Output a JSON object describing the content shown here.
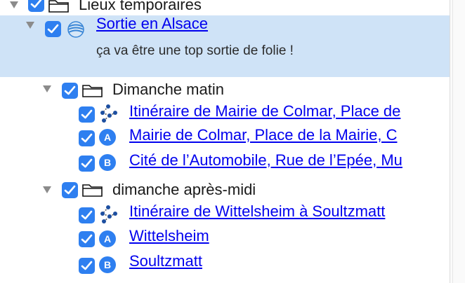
{
  "tree": {
    "root": {
      "label": "Lieux temporaires"
    },
    "sortie": {
      "title": "Sortie en Alsace",
      "description": "ça va être une top sortie de folie !"
    },
    "folders": [
      {
        "label": "Dimanche matin",
        "items": [
          {
            "type": "route",
            "icon": "route-icon",
            "label": "Itinéraire de Mairie de Colmar, Place de"
          },
          {
            "type": "marker-a",
            "icon": "marker-a-icon",
            "label": "Mairie de Colmar, Place de la Mairie, C"
          },
          {
            "type": "marker-b",
            "icon": "marker-b-icon",
            "label": "Cité de l’Automobile, Rue de l’Epée, Mu"
          }
        ]
      },
      {
        "label": "dimanche après-midi",
        "items": [
          {
            "type": "route",
            "icon": "route-icon",
            "label": "Itinéraire de Wittelsheim à Soultzmatt"
          },
          {
            "type": "marker-a",
            "icon": "marker-a-icon",
            "label": "Wittelsheim"
          },
          {
            "type": "marker-b",
            "icon": "marker-b-icon",
            "label": "Soultzmatt"
          }
        ]
      }
    ]
  },
  "colors": {
    "selection": "#cfe3f7",
    "checkbox": "#2e7ff0",
    "link": "#0000ee"
  }
}
